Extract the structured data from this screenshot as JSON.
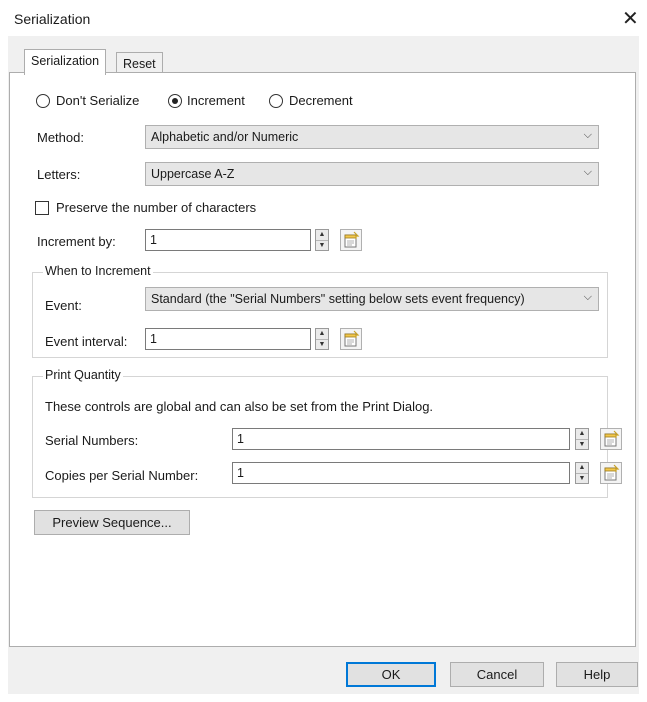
{
  "window": {
    "title": "Serialization",
    "close_glyph": "✕"
  },
  "tabs": [
    {
      "label": "Serialization",
      "active": true
    },
    {
      "label": "Reset",
      "active": false
    }
  ],
  "mode": {
    "options": [
      {
        "label": "Don't Serialize",
        "selected": false
      },
      {
        "label": "Increment",
        "selected": true
      },
      {
        "label": "Decrement",
        "selected": false
      }
    ]
  },
  "method": {
    "label": "Method:",
    "value": "Alphabetic and/or Numeric"
  },
  "letters": {
    "label": "Letters:",
    "value": "Uppercase A-Z"
  },
  "preserve": {
    "label": "Preserve the number of characters",
    "checked": false
  },
  "increment_by": {
    "label": "Increment by:",
    "value": "1"
  },
  "when_to_increment": {
    "title": "When to Increment",
    "event_label": "Event:",
    "event_value": "Standard (the \"Serial Numbers\" setting below sets event frequency)",
    "interval_label": "Event interval:",
    "interval_value": "1"
  },
  "print_quantity": {
    "title": "Print Quantity",
    "description": "These controls are global and can also be set from the Print Dialog.",
    "serial_label": "Serial Numbers:",
    "serial_value": "1",
    "copies_label": "Copies per Serial Number:",
    "copies_value": "1"
  },
  "buttons": {
    "preview": "Preview Sequence...",
    "ok": "OK",
    "cancel": "Cancel",
    "help": "Help"
  },
  "icons": {
    "dropdown": "chevron-down-icon",
    "spin_up": "up-arrow-icon",
    "spin_down": "down-arrow-icon",
    "data_source": "data-source-icon"
  },
  "colors": {
    "default_button_border": "#0078d7",
    "dialog_bg": "#f0f0f0"
  }
}
